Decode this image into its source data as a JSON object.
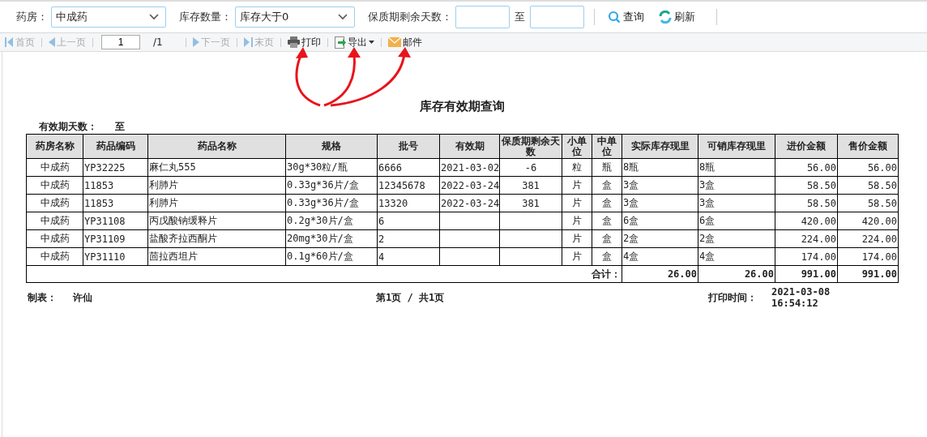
{
  "filter_bar": {
    "pharmacy": {
      "label": "药房：",
      "value": "中成药"
    },
    "stock": {
      "label": "库存数量：",
      "value": "库存大于0"
    },
    "shelf_days": {
      "label": "保质期剩余天数：",
      "to": "至"
    },
    "buttons": [
      {
        "kind": "search",
        "label": "查询"
      },
      {
        "kind": "refresh",
        "label": "刷新"
      }
    ]
  },
  "pager": {
    "items": [
      {
        "kind": "first",
        "label": "首页",
        "disabled": true
      },
      {
        "kind": "prev",
        "label": "上一页",
        "disabled": true
      }
    ],
    "page": "1",
    "total": "/1",
    "items_after": [
      {
        "kind": "next",
        "label": "下一页",
        "disabled": true
      },
      {
        "kind": "last",
        "label": "末页",
        "disabled": true
      },
      {
        "kind": "print",
        "label": "打印",
        "disabled": false
      },
      {
        "kind": "export",
        "label": "导出",
        "disabled": false,
        "dropdown": true
      },
      {
        "kind": "mail",
        "label": "邮件",
        "disabled": false
      }
    ]
  },
  "report": {
    "title": "库存有效期查询",
    "days_label": "有效期天数：",
    "days_to": "至",
    "columns": [
      "药房名称",
      "药品编码",
      "药品名称",
      "规格",
      "批号",
      "有效期",
      "保质期剩余天数",
      "小单位",
      "中单位",
      "实际库存现里",
      "可销库存现里",
      "进价金额",
      "售价金额"
    ],
    "rows": [
      [
        "中成药",
        "YP32225",
        "麻仁丸555",
        "30g*30粒/瓶",
        "6666",
        "2021-03-02",
        "-6",
        "粒",
        "瓶",
        "8瓶",
        "8瓶",
        "56.00",
        "56.00"
      ],
      [
        "中成药",
        "11853",
        "利肺片",
        "0.33g*36片/盒",
        "12345678",
        "2022-03-24",
        "381",
        "片",
        "盒",
        "3盒",
        "3盒",
        "58.50",
        "58.50"
      ],
      [
        "中成药",
        "11853",
        "利肺片",
        "0.33g*36片/盒",
        "13320",
        "2022-03-24",
        "381",
        "片",
        "盒",
        "3盒",
        "3盒",
        "58.50",
        "58.50"
      ],
      [
        "中成药",
        "YP31108",
        "丙戊酸钠缓释片",
        "0.2g*30片/盒",
        "6",
        "",
        "",
        "片",
        "盒",
        "6盒",
        "6盒",
        "420.00",
        "420.00"
      ],
      [
        "中成药",
        "YP31109",
        "盐酸齐拉西酮片",
        "20mg*30片/盒",
        "2",
        "",
        "",
        "片",
        "盒",
        "2盒",
        "2盒",
        "224.00",
        "224.00"
      ],
      [
        "中成药",
        "YP31110",
        "茴拉西坦片",
        "0.1g*60片/盒",
        "4",
        "",
        "",
        "片",
        "盒",
        "4盒",
        "4盒",
        "174.00",
        "174.00"
      ]
    ],
    "total_label": "合计：",
    "totals": [
      "26.00",
      "26.00",
      "991.00",
      "991.00"
    ],
    "maker_label": "制表：",
    "maker": "许仙",
    "page_info": "第1页 / 共1页",
    "print_label": "打印时间：",
    "print_date": "2021-03-08",
    "print_time": "16:54:12"
  }
}
